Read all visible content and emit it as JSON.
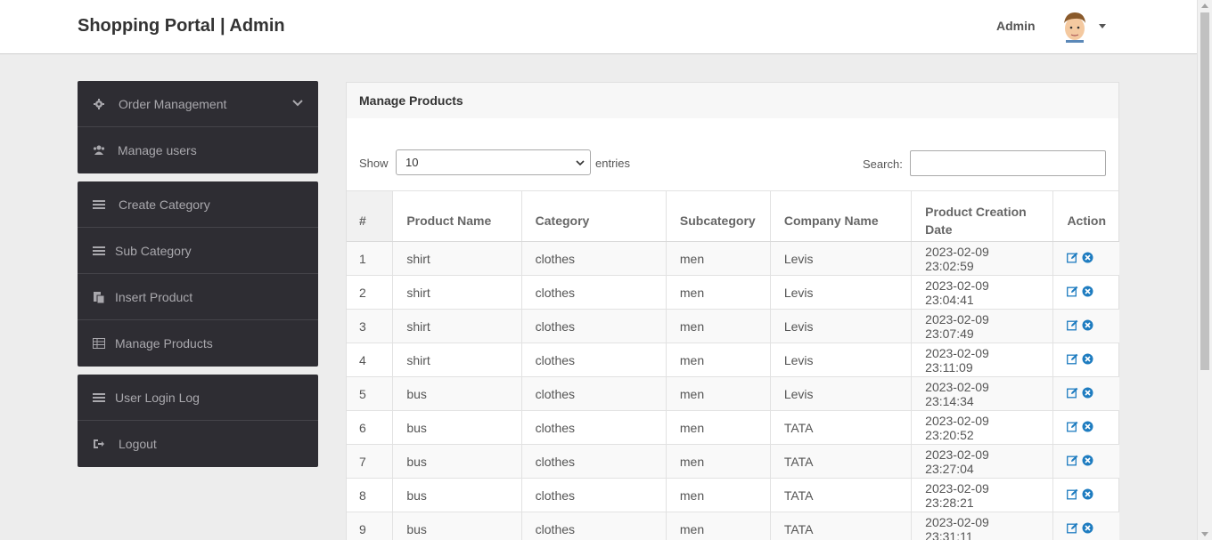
{
  "header": {
    "title": "Shopping Portal | Admin",
    "user_label": "Admin"
  },
  "sidebar": {
    "group1": [
      {
        "label": "Order Management",
        "icon": "gear-icon"
      },
      {
        "label": "Manage users",
        "icon": "users-icon"
      }
    ],
    "group2": [
      {
        "label": "Create Category",
        "icon": "tasks-icon"
      },
      {
        "label": "Sub Category",
        "icon": "tasks-icon"
      },
      {
        "label": "Insert Product",
        "icon": "paste-icon"
      },
      {
        "label": "Manage Products",
        "icon": "table-icon"
      }
    ],
    "group3": [
      {
        "label": "User Login Log",
        "icon": "tasks-icon"
      },
      {
        "label": "Logout",
        "icon": "sign-out-icon"
      }
    ]
  },
  "panel": {
    "title": "Manage Products",
    "show_label": "Show",
    "length_value": "10",
    "entries_label": "entries",
    "search_label": "Search:",
    "search_value": ""
  },
  "table": {
    "headers": [
      "#",
      "Product Name",
      "Category",
      "Subcategory",
      "Company Name",
      "Product Creation Date",
      "Action"
    ],
    "rows": [
      [
        "1",
        "shirt",
        "clothes",
        "men",
        "Levis",
        "2023-02-09 23:02:59"
      ],
      [
        "2",
        "shirt",
        "clothes",
        "men",
        "Levis",
        "2023-02-09 23:04:41"
      ],
      [
        "3",
        "shirt",
        "clothes",
        "men",
        "Levis",
        "2023-02-09 23:07:49"
      ],
      [
        "4",
        "shirt",
        "clothes",
        "men",
        "Levis",
        "2023-02-09 23:11:09"
      ],
      [
        "5",
        "bus",
        "clothes",
        "men",
        "Levis",
        "2023-02-09 23:14:34"
      ],
      [
        "6",
        "bus",
        "clothes",
        "men",
        "TATA",
        "2023-02-09 23:20:52"
      ],
      [
        "7",
        "bus",
        "clothes",
        "men",
        "TATA",
        "2023-02-09 23:27:04"
      ],
      [
        "8",
        "bus",
        "clothes",
        "men",
        "TATA",
        "2023-02-09 23:28:21"
      ],
      [
        "9",
        "bus",
        "clothes",
        "men",
        "TATA",
        "2023-02-09 23:31:11"
      ]
    ]
  },
  "colors": {
    "sidebar_bg": "#2e2d33",
    "action_blue": "#1e7cc0"
  }
}
